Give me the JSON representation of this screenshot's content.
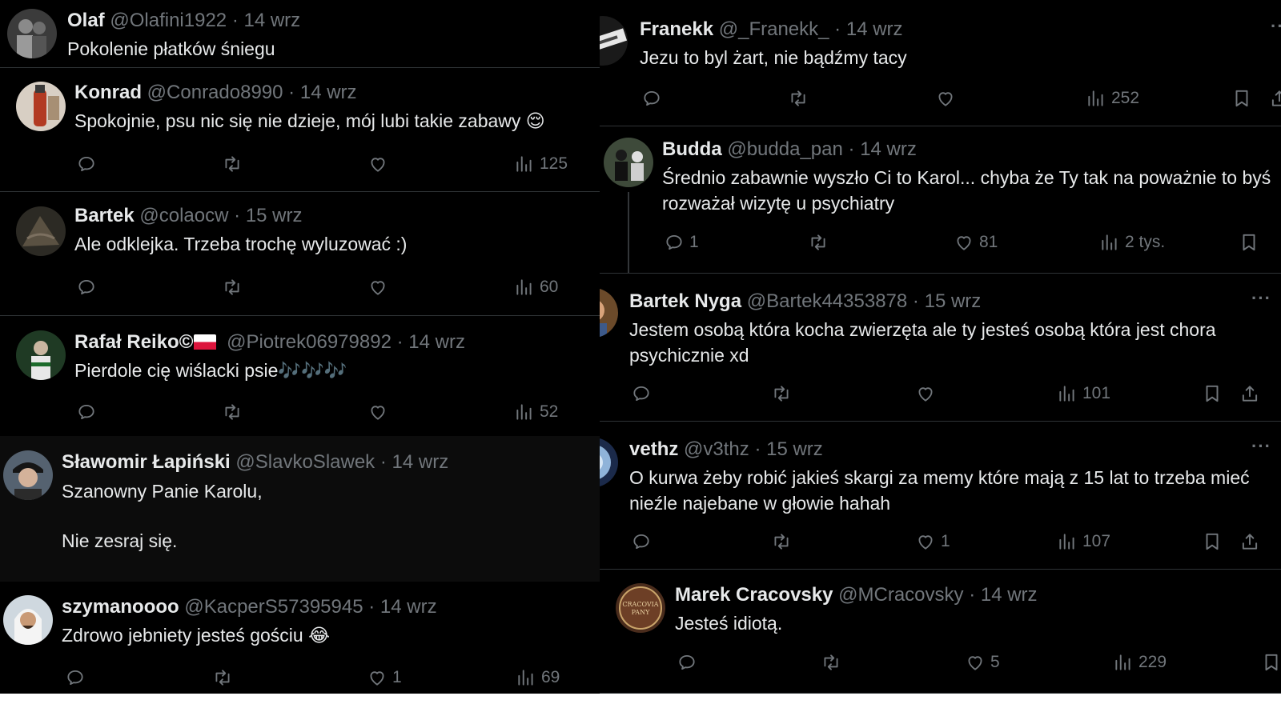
{
  "left_column": [
    {
      "name": "Olaf",
      "handle": "@Olafini1922",
      "date": "14 wrz",
      "text": "Pokolenie płatków śniegu",
      "replies": "",
      "reposts": "",
      "likes": "",
      "views": ""
    },
    {
      "name": "Konrad",
      "handle": "@Conrado8990",
      "date": "14 wrz",
      "text": "Spokojnie, psu nic się nie dzieje, mój lubi takie zabawy 😌",
      "replies": "",
      "reposts": "",
      "likes": "",
      "views": "125"
    },
    {
      "name": "Bartek",
      "handle": "@colaocw",
      "date": "15 wrz",
      "text": "Ale odklejka. Trzeba trochę wyluzować :)",
      "replies": "",
      "reposts": "",
      "likes": "",
      "views": "60"
    },
    {
      "name": "Rafał Reiko",
      "handle": "@Piotrek06979892",
      "date": "14 wrz",
      "text": "Pierdole cię wiślacki psie🎶🎶🎶",
      "replies": "",
      "reposts": "",
      "likes": "",
      "views": "52"
    },
    {
      "name": "Sławomir Łapiński",
      "handle": "@SlavkoSlawek",
      "date": "14 wrz",
      "line1": "Szanowny Panie Karolu,",
      "line2": "Nie zesraj się."
    },
    {
      "name": "szymanoooo",
      "handle": "@KacperS57395945",
      "date": "14 wrz",
      "text": "Zdrowo jebniety  jesteś gościu 😂",
      "replies": "",
      "reposts": "",
      "likes": "1",
      "views": "69"
    }
  ],
  "right_column": [
    {
      "name": "Franekk",
      "handle": "@_Franekk_",
      "date": "14 wrz",
      "text": "Jezu to byl żart, nie bądźmy tacy",
      "replies": "",
      "reposts": "",
      "likes": "",
      "views": "252"
    },
    {
      "name": "Budda",
      "handle": "@budda_pan",
      "date": "14 wrz",
      "line1": "Średnio zabawnie wyszło Ci to Karol... chyba że Ty tak na poważnie to byś",
      "line2": "rozważał wizytę u psychiatry",
      "replies": "1",
      "reposts": "",
      "likes": "81",
      "views": "2 tys."
    },
    {
      "name": "Bartek Nyga",
      "handle": "@Bartek44353878",
      "date": "15 wrz",
      "line1": "Jestem osobą która kocha zwierzęta ale ty jesteś osobą która jest chora",
      "line2": "psychicznie xd",
      "replies": "",
      "reposts": "",
      "likes": "",
      "views": "101"
    },
    {
      "name": "vethz",
      "handle": "@v3thz",
      "date": "15 wrz",
      "line1": "O kurwa żeby robić jakieś skargi za memy które mają z 15 lat to trzeba mieć",
      "line2": "nieźle najebane w głowie hahah",
      "replies": "",
      "reposts": "",
      "likes": "1",
      "views": "107"
    },
    {
      "name": "Marek Cracovsky",
      "handle": "@MCracovsky",
      "date": "14 wrz",
      "text": "Jesteś idiotą.",
      "replies": "",
      "reposts": "",
      "likes": "5",
      "views": "229"
    }
  ],
  "ui": {
    "dot": "·",
    "more": "···",
    "avatar_badge_text": "CRACOVIA PANY"
  },
  "colors": {
    "background": "#000000",
    "text": "#e7e9ea",
    "muted": "#71767b",
    "separator": "#2f3336",
    "flag_red": "#dc143c",
    "note_blue": "#1d9bf0"
  },
  "icons": [
    "reply-icon",
    "repost-icon",
    "like-icon",
    "views-icon",
    "bookmark-icon",
    "share-icon",
    "more-icon",
    "poland-flag-icon",
    "music-notes-icon"
  ]
}
